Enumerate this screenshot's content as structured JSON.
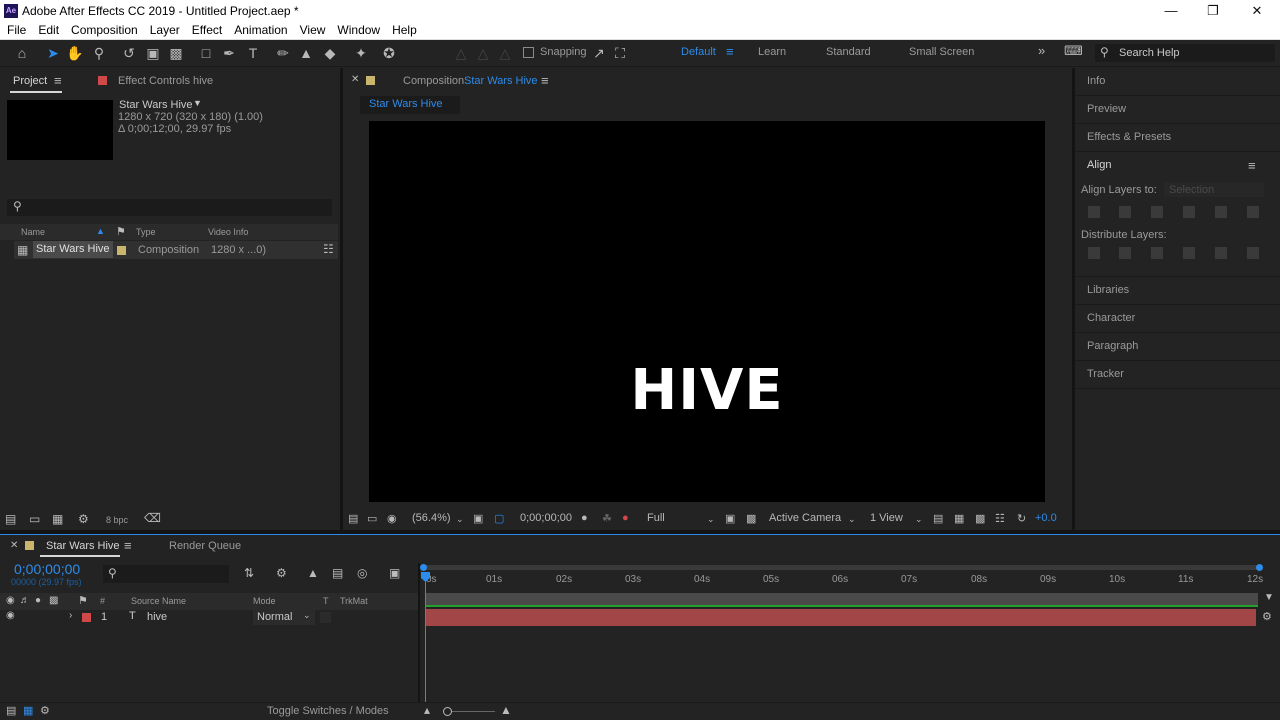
{
  "window": {
    "app_badge": "Ae",
    "title": "Adobe After Effects CC 2019 - Untitled Project.aep *"
  },
  "menu": [
    "File",
    "Edit",
    "Composition",
    "Layer",
    "Effect",
    "Animation",
    "View",
    "Window",
    "Help"
  ],
  "toolbar": {
    "snapping_label": "Snapping",
    "workspaces": [
      "Default",
      "Learn",
      "Standard",
      "Small Screen"
    ],
    "search_placeholder": "Search Help"
  },
  "project_panel": {
    "tab_label": "Project",
    "effect_controls_label": "Effect Controls hive",
    "item_name": "Star Wars Hive",
    "item_dims": "1280 x 720  (320 x 180) (1.00)",
    "item_duration": "Δ 0;00;12;00, 29.97 fps",
    "columns": [
      "Name",
      "Type",
      "Video Info"
    ],
    "rows": [
      {
        "name": "Star Wars Hive",
        "type": "Composition",
        "video_info": "1280 x ...0)",
        "label_color": "#c9b56b"
      }
    ],
    "bpc": "8 bpc"
  },
  "composition_panel": {
    "prefix": "Composition",
    "comp_name": "Star Wars Hive",
    "subtab": "Star Wars Hive",
    "canvas_text": "HIVE",
    "zoom": "(56.4%)",
    "timecode": "0;00;00;00",
    "resolution": "Full",
    "camera": "Active Camera",
    "views": "1 View",
    "exposure": "+0.0"
  },
  "right_panel": {
    "info": "Info",
    "preview": "Preview",
    "effects_presets": "Effects & Presets",
    "align_title": "Align",
    "align_layers_to": "Align Layers to:",
    "align_target": "Selection",
    "distribute_layers": "Distribute Layers:",
    "libraries": "Libraries",
    "character": "Character",
    "paragraph": "Paragraph",
    "tracker": "Tracker"
  },
  "timeline": {
    "tab_label": "Star Wars Hive",
    "render_queue": "Render Queue",
    "current_time": "0;00;00;00",
    "frame_info": "00000 (29.97 fps)",
    "col_hash": "#",
    "col_source": "Source Name",
    "col_mode": "Mode",
    "col_t": "T",
    "col_trkmat": "TrkMat",
    "ruler_marks": [
      "0s",
      "01s",
      "02s",
      "03s",
      "04s",
      "05s",
      "06s",
      "07s",
      "08s",
      "09s",
      "10s",
      "11s",
      "12s"
    ],
    "layers": [
      {
        "index": "1",
        "type_icon": "T",
        "name": "hive",
        "mode": "Normal",
        "label_color": "#d14848"
      }
    ],
    "toggle_label": "Toggle Switches / Modes"
  },
  "colors": {
    "accent": "#2d8ceb",
    "layer_bar": "#a24647",
    "work_area_line": "#25a02c"
  }
}
